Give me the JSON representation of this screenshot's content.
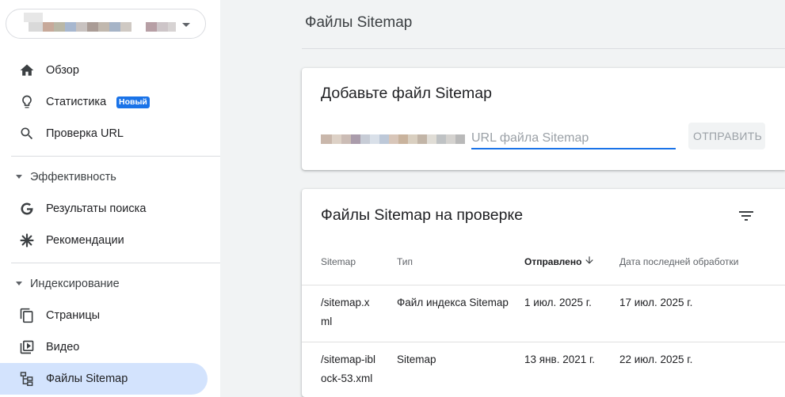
{
  "sidebar": {
    "items": [
      {
        "label": "Обзор",
        "icon": "home-icon"
      },
      {
        "label": "Статистика",
        "icon": "lightbulb-icon",
        "badge": "Новый"
      },
      {
        "label": "Проверка URL",
        "icon": "search-icon"
      }
    ],
    "sections": [
      {
        "label": "Эффективность",
        "items": [
          {
            "label": "Результаты поиска",
            "icon": "google-g-icon"
          },
          {
            "label": "Рекомендации",
            "icon": "asterisk-icon"
          }
        ]
      },
      {
        "label": "Индексирование",
        "items": [
          {
            "label": "Страницы",
            "icon": "pages-icon"
          },
          {
            "label": "Видео",
            "icon": "video-icon"
          },
          {
            "label": "Файлы Sitemap",
            "icon": "sitemap-icon",
            "active": true
          }
        ]
      }
    ]
  },
  "header": {
    "title": "Файлы Sitemap"
  },
  "add_card": {
    "title": "Добавьте файл Sitemap",
    "input_placeholder": "URL файла Sitemap",
    "submit_label": "ОТПРАВИТЬ"
  },
  "list_card": {
    "title": "Файлы Sitemap на проверке",
    "columns": [
      "Sitemap",
      "Тип",
      "Отправлено",
      "Дата последней обработки"
    ],
    "rows": [
      {
        "sitemap": [
          "/sitemap.x",
          "ml"
        ],
        "type": "Файл индекса Sitemap",
        "submitted": "1 июл. 2025 г.",
        "last_read": "17 июл. 2025 г."
      },
      {
        "sitemap": [
          "/sitemap-ibl",
          "ock-53.xml"
        ],
        "type": "Sitemap",
        "submitted": "13 янв. 2021 г.",
        "last_read": "22 июл. 2025 г."
      }
    ]
  },
  "colors": {
    "accent": "#1a73e8",
    "active_nav": "#d3e3fd",
    "background": "#f1f3f4"
  }
}
